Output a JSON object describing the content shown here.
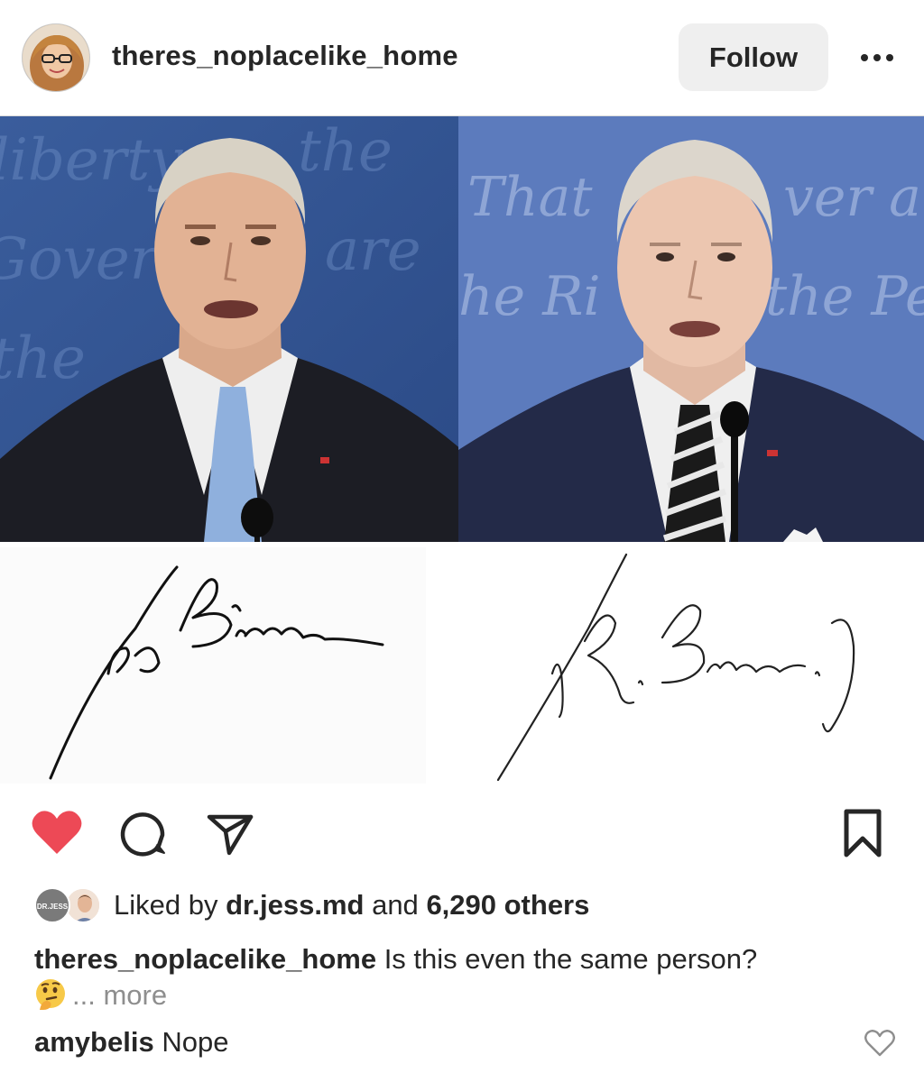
{
  "header": {
    "username": "theres_noplacelike_home",
    "follow_label": "Follow"
  },
  "post_image": {
    "left_signature_text": "Joe Biden",
    "right_signature_text": "J. R. Biden, Jr."
  },
  "actions": {
    "like_icon": "heart-icon",
    "like_color": "#ed4956",
    "comment_icon": "comment-icon",
    "share_icon": "send-icon",
    "save_icon": "bookmark-icon",
    "liked": true
  },
  "likes": {
    "prefix": "Liked by",
    "first_liker": "dr.jess.md",
    "first_liker_avatar_text": "DR.JESS",
    "connector": "and",
    "others": "6,290 others"
  },
  "caption": {
    "username": "theres_noplacelike_home",
    "text": "Is this even the same person?",
    "emoji": "thinking-face-emoji",
    "more_label": "... more"
  },
  "comment": {
    "username": "amybelis",
    "text": "Nope"
  }
}
